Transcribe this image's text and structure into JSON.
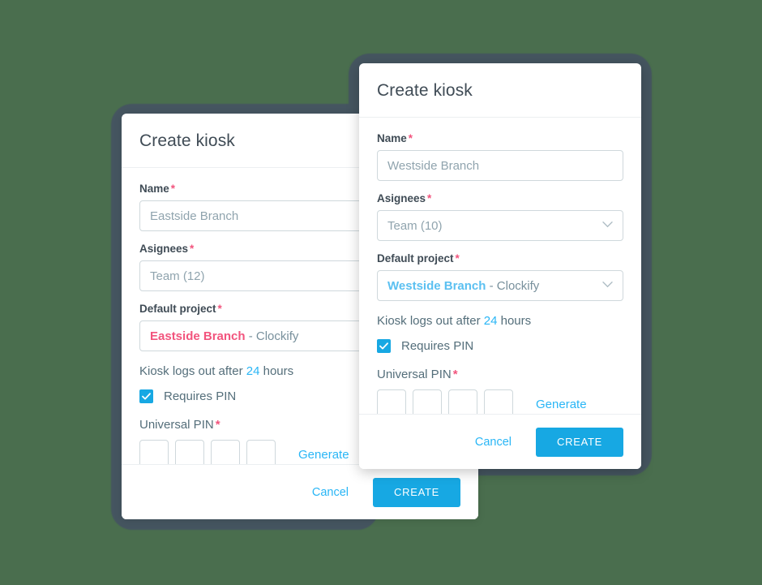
{
  "theme": {
    "page_background": "#4a6e4e",
    "backdrop_color": "#455560",
    "accent_blue": "#17a8e3",
    "link_blue": "#29b6f6",
    "required_pink": "#f2547d",
    "label_color": "#3f4b55"
  },
  "dialogs": [
    {
      "id": "back",
      "title": "Create kiosk",
      "name": {
        "label": "Name",
        "required_marker": "*",
        "placeholder": "Eastside Branch",
        "value": ""
      },
      "assignees": {
        "label": "Asignees",
        "required_marker": "*",
        "value": "Team (12)",
        "chevron_icon": "chevron-down-icon"
      },
      "default_project": {
        "label": "Default project",
        "required_marker": "*",
        "project_name": "Eastside Branch",
        "project_name_color": "#f2547d",
        "separator": " - ",
        "workspace": "Clockify",
        "chevron_icon": "chevron-down-icon"
      },
      "logout": {
        "prefix": "Kiosk logs out after",
        "hours": "24",
        "suffix": "hours"
      },
      "requires_pin": {
        "label": "Requires PIN",
        "checked": true,
        "check_icon": "checkmark-icon"
      },
      "universal_pin": {
        "label": "Universal PIN",
        "required_marker": "*",
        "digits": [
          "",
          "",
          "",
          ""
        ],
        "generate_label": "Generate"
      },
      "footer": {
        "cancel_label": "Cancel",
        "create_label": "CREATE"
      }
    },
    {
      "id": "front",
      "title": "Create kiosk",
      "name": {
        "label": "Name",
        "required_marker": "*",
        "placeholder": "Westside Branch",
        "value": ""
      },
      "assignees": {
        "label": "Asignees",
        "required_marker": "*",
        "value": "Team (10)",
        "chevron_icon": "chevron-down-icon"
      },
      "default_project": {
        "label": "Default project",
        "required_marker": "*",
        "project_name": "Westside Branch",
        "project_name_color": "#5bc0f1",
        "separator": " - ",
        "workspace": "Clockify",
        "chevron_icon": "chevron-down-icon"
      },
      "logout": {
        "prefix": "Kiosk logs out after",
        "hours": "24",
        "suffix": "hours"
      },
      "requires_pin": {
        "label": "Requires PIN",
        "checked": true,
        "check_icon": "checkmark-icon"
      },
      "universal_pin": {
        "label": "Universal PIN",
        "required_marker": "*",
        "digits": [
          "",
          "",
          "",
          ""
        ],
        "generate_label": "Generate"
      },
      "footer": {
        "cancel_label": "Cancel",
        "create_label": "CREATE"
      }
    }
  ]
}
